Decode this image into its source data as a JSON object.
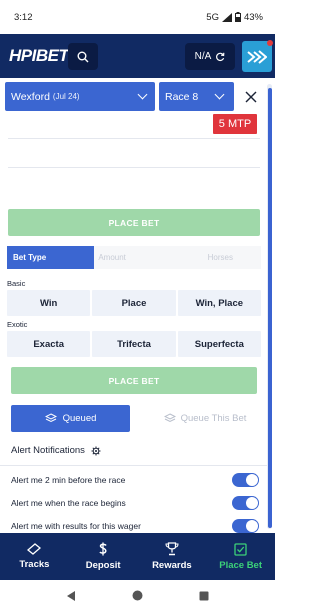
{
  "status_bar": {
    "time": "3:12",
    "network": "5G",
    "battery": "43%"
  },
  "header": {
    "logo": "HPIBET",
    "balance": "N/A"
  },
  "race_selector": {
    "track": "Wexford",
    "date": "(Jul 24)",
    "race": "Race 8",
    "mtp": "5 MTP"
  },
  "place_bet_label": "PLACE BET",
  "tabs": [
    {
      "label": "Bet Type"
    },
    {
      "label": "Amount"
    },
    {
      "label": "Horses"
    }
  ],
  "basic": {
    "label": "Basic",
    "options": [
      "Win",
      "Place",
      "Win, Place"
    ]
  },
  "exotic": {
    "label": "Exotic",
    "options": [
      "Exacta",
      "Trifecta",
      "Superfecta"
    ]
  },
  "queue": {
    "queued_label": "Queued",
    "queue_this_label": "Queue This Bet"
  },
  "alerts": {
    "title": "Alert Notifications",
    "items": [
      {
        "label": "Alert me 2 min before the race",
        "enabled": true
      },
      {
        "label": "Alert me when the race begins",
        "enabled": true
      },
      {
        "label": "Alert me with results for this wager",
        "enabled": true
      }
    ]
  },
  "bottom_nav": [
    {
      "label": "Tracks",
      "icon": "ticket-icon"
    },
    {
      "label": "Deposit",
      "icon": "dollar-icon"
    },
    {
      "label": "Rewards",
      "icon": "trophy-icon"
    },
    {
      "label": "Place Bet",
      "icon": "checkbox-icon"
    }
  ],
  "colors": {
    "header": "#112a63",
    "accent": "#3b66d1",
    "success": "#3cd179",
    "place_bet_disabled": "#9fd8a9",
    "mtp": "#e0353c"
  }
}
